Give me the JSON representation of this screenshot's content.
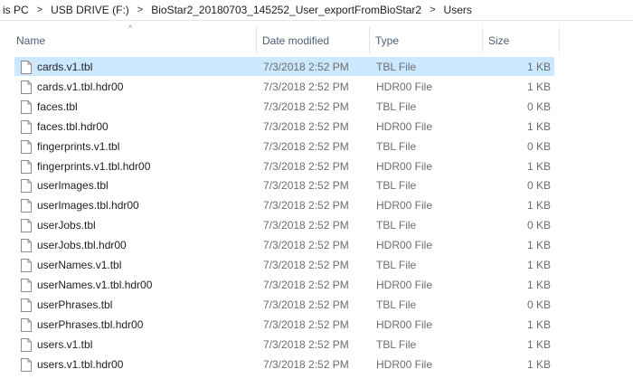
{
  "breadcrumb": {
    "items": [
      "is PC",
      "USB DRIVE (F:)",
      "BioStar2_20180703_145252_User_exportFromBioStar2",
      "Users"
    ],
    "separator": ">"
  },
  "columns": {
    "name": "Name",
    "date": "Date modified",
    "type": "Type",
    "size": "Size",
    "sort_indicator": "^"
  },
  "files": [
    {
      "name": "cards.v1.tbl",
      "date": "7/3/2018 2:52 PM",
      "type": "TBL File",
      "size": "1 KB",
      "selected": true
    },
    {
      "name": "cards.v1.tbl.hdr00",
      "date": "7/3/2018 2:52 PM",
      "type": "HDR00 File",
      "size": "1 KB"
    },
    {
      "name": "faces.tbl",
      "date": "7/3/2018 2:52 PM",
      "type": "TBL File",
      "size": "0 KB"
    },
    {
      "name": "faces.tbl.hdr00",
      "date": "7/3/2018 2:52 PM",
      "type": "HDR00 File",
      "size": "1 KB"
    },
    {
      "name": "fingerprints.v1.tbl",
      "date": "7/3/2018 2:52 PM",
      "type": "TBL File",
      "size": "0 KB"
    },
    {
      "name": "fingerprints.v1.tbl.hdr00",
      "date": "7/3/2018 2:52 PM",
      "type": "HDR00 File",
      "size": "1 KB"
    },
    {
      "name": "userImages.tbl",
      "date": "7/3/2018 2:52 PM",
      "type": "TBL File",
      "size": "0 KB"
    },
    {
      "name": "userImages.tbl.hdr00",
      "date": "7/3/2018 2:52 PM",
      "type": "HDR00 File",
      "size": "1 KB"
    },
    {
      "name": "userJobs.tbl",
      "date": "7/3/2018 2:52 PM",
      "type": "TBL File",
      "size": "0 KB"
    },
    {
      "name": "userJobs.tbl.hdr00",
      "date": "7/3/2018 2:52 PM",
      "type": "HDR00 File",
      "size": "1 KB"
    },
    {
      "name": "userNames.v1.tbl",
      "date": "7/3/2018 2:52 PM",
      "type": "TBL File",
      "size": "1 KB"
    },
    {
      "name": "userNames.v1.tbl.hdr00",
      "date": "7/3/2018 2:52 PM",
      "type": "HDR00 File",
      "size": "1 KB"
    },
    {
      "name": "userPhrases.tbl",
      "date": "7/3/2018 2:52 PM",
      "type": "TBL File",
      "size": "0 KB"
    },
    {
      "name": "userPhrases.tbl.hdr00",
      "date": "7/3/2018 2:52 PM",
      "type": "HDR00 File",
      "size": "1 KB"
    },
    {
      "name": "users.v1.tbl",
      "date": "7/3/2018 2:52 PM",
      "type": "TBL File",
      "size": "1 KB"
    },
    {
      "name": "users.v1.tbl.hdr00",
      "date": "7/3/2018 2:52 PM",
      "type": "HDR00 File",
      "size": "1 KB"
    }
  ],
  "file_icon": "generic-file-icon",
  "colors": {
    "selection": "#cce8ff",
    "header_text": "#4c607a",
    "secondary_text": "#6d6d6d"
  }
}
